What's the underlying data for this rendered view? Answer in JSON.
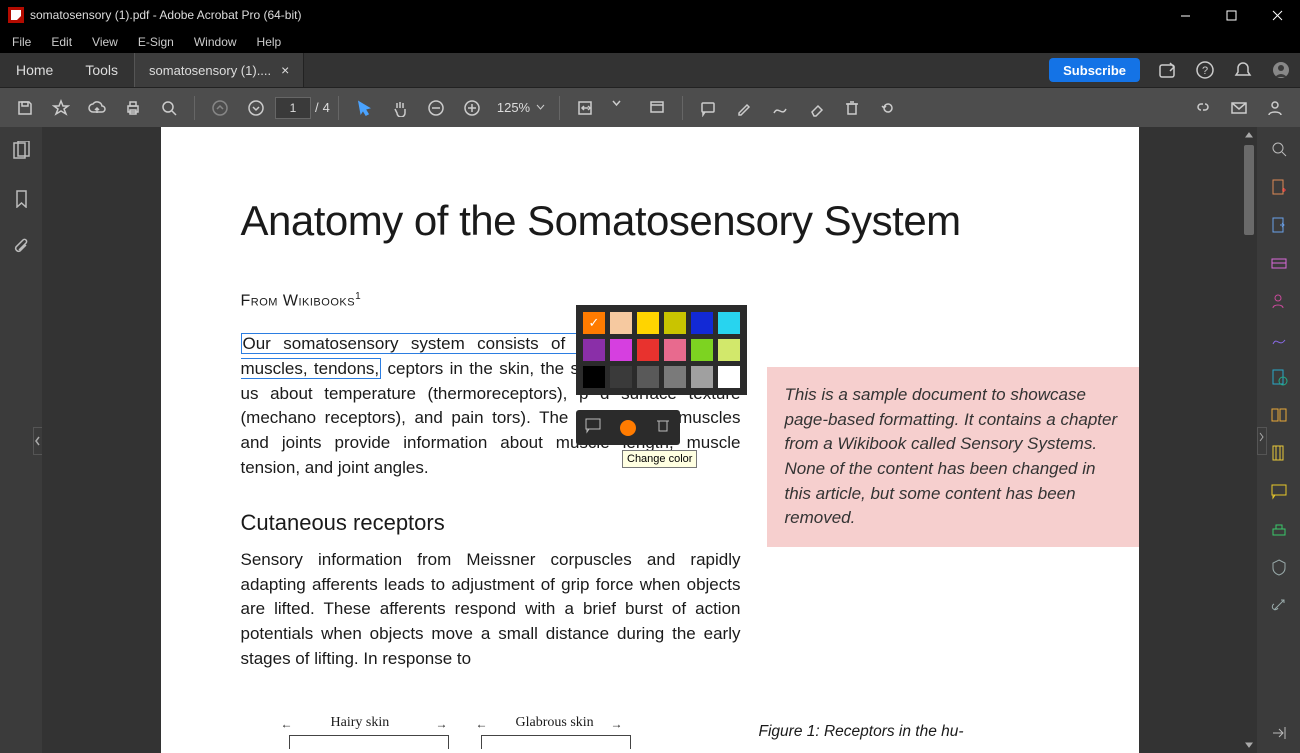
{
  "window": {
    "title": "somatosensory (1).pdf - Adobe Acrobat Pro (64-bit)"
  },
  "menu": {
    "items": [
      "File",
      "Edit",
      "View",
      "E-Sign",
      "Window",
      "Help"
    ]
  },
  "tabs": {
    "home": "Home",
    "tools": "Tools",
    "file_label": "somatosensory (1)....",
    "subscribe": "Subscribe"
  },
  "page_nav": {
    "current": "1",
    "sep": "/",
    "total": "4",
    "zoom": "125%"
  },
  "doc": {
    "title": "Anatomy of the Somatosensory System",
    "from_pre": "From Wikibooks",
    "from_sup": "1",
    "p1_sel": "Our somatosensory system consists of and sensors in our muscles, tendons,",
    "p1_rest": "ceptors in the skin, the so called cutan           rs, tell us about temperature (thermoreceptors), p             d surface texture (mechano receptors), and pain               tors). The receptors in muscles and joints provide information about muscle length, muscle tension, and joint angles.",
    "h2": "Cutaneous receptors",
    "p2": "Sensory information from Meissner corpuscles and rapidly adapting afferents leads to adjustment of grip force when objects are lifted. These afferents respond with a brief burst of action potentials when objects move a small distance during the early stages of lifting. In response to",
    "note": "This is a sample document to showcase page-based formatting. It contains a chapter from a Wikibook called Sensory Systems. None of the content has been changed in this article, but some content has been removed.",
    "fig_hairy": "Hairy skin",
    "fig_glab": "Glabrous skin",
    "figcap": "Figure 1:  Receptors in the hu-"
  },
  "popup": {
    "tooltip": "Change color",
    "colors": [
      [
        "#ff7b00",
        "#f6c9a0",
        "#ffd400",
        "#c9c400",
        "#1229d6",
        "#28d4ef"
      ],
      [
        "#8a2fa8",
        "#d63fe0",
        "#e8322e",
        "#e86a8e",
        "#7dd321",
        "#d2e86b"
      ],
      [
        "#000000",
        "#3a3a3a",
        "#595959",
        "#7a7a7a",
        "#a0a0a0",
        "#ffffff"
      ]
    ],
    "selected": "#ff7b00"
  }
}
